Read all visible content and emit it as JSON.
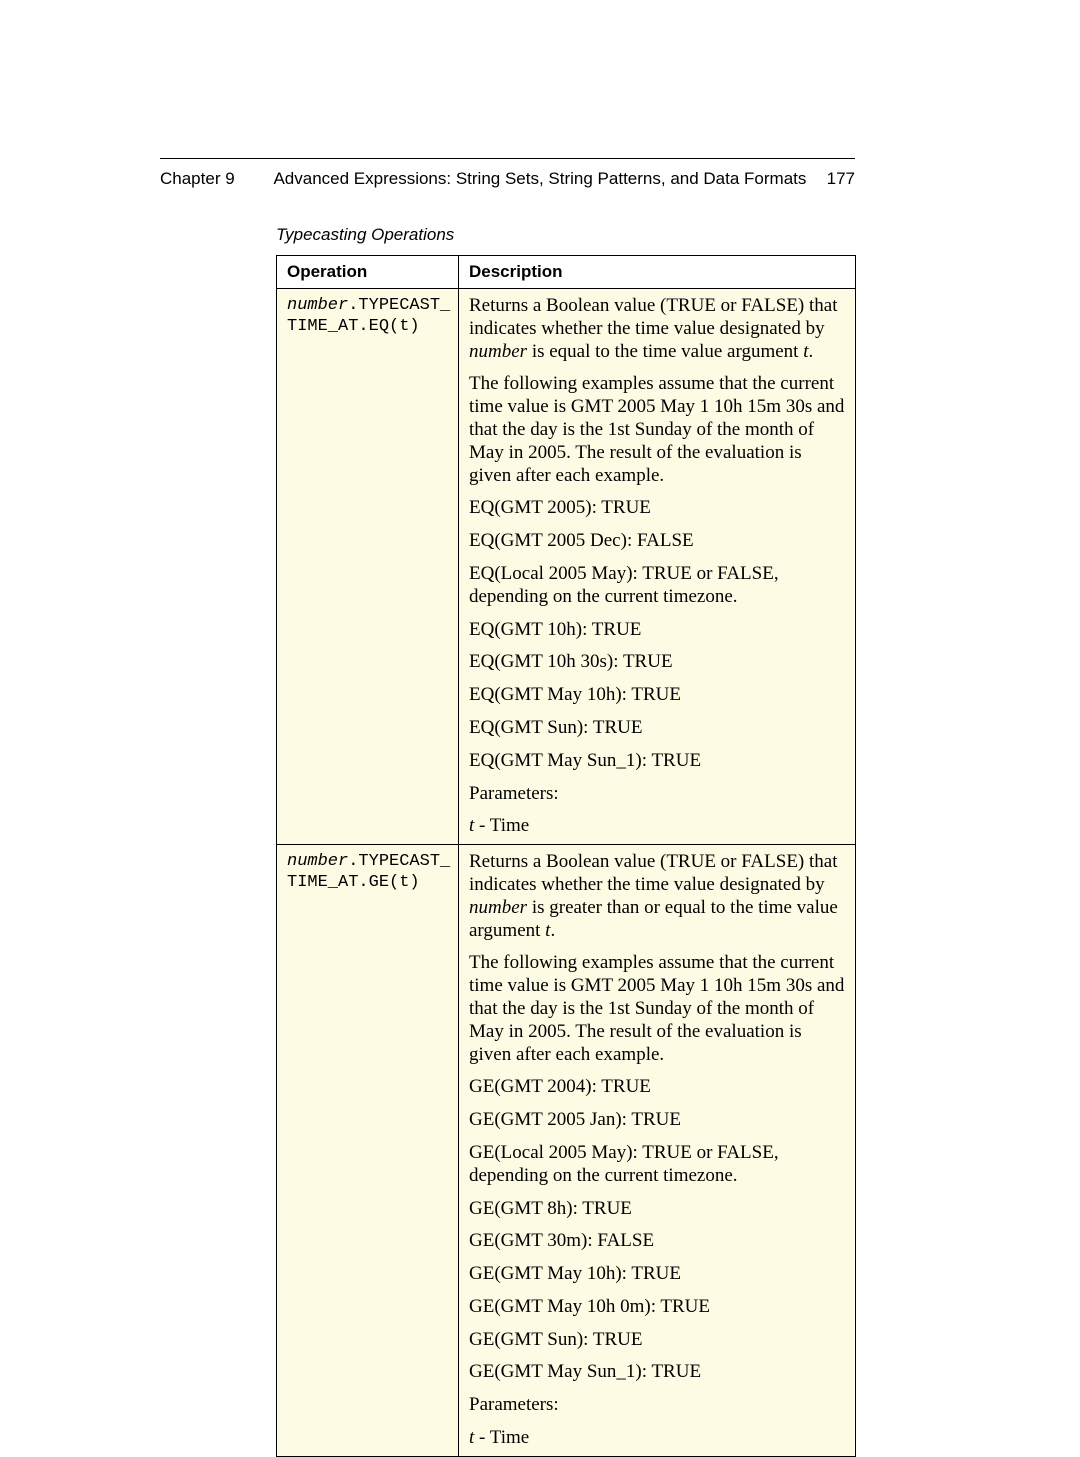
{
  "header": {
    "chapter": "Chapter 9",
    "title": "Advanced Expressions: String Sets, String Patterns, and Data Formats",
    "page": "177"
  },
  "caption": "Typecasting Operations",
  "columns": {
    "operation": "Operation",
    "description": "Description"
  },
  "rows": [
    {
      "op_prefix": "number",
      "op_code_line1": ".TYPECAST_",
      "op_code_line2": "TIME_AT.EQ(t)",
      "desc": {
        "intro_a": "Returns a Boolean value (TRUE or FALSE) that indicates whether the time value designated by ",
        "intro_num": "number",
        "intro_b": " is equal to the time value argument ",
        "intro_t": "t",
        "intro_c": ".",
        "assume": "The following examples assume that the current time value is GMT 2005 May 1 10h 15m 30s and that the day is the 1st Sunday of the month of May in 2005. The result of the evaluation is given after each example.",
        "ex1": "EQ(GMT 2005): TRUE",
        "ex2": "EQ(GMT 2005 Dec): FALSE",
        "ex3": "EQ(Local 2005 May): TRUE or FALSE, depending on the current timezone.",
        "ex4": "EQ(GMT 10h): TRUE",
        "ex5": "EQ(GMT 10h 30s): TRUE",
        "ex6": "EQ(GMT May 10h): TRUE",
        "ex7": "EQ(GMT Sun): TRUE",
        "ex8": "EQ(GMT May Sun_1): TRUE",
        "params_label": "Parameters:",
        "param_t_letter": "t",
        "param_t_rest": " - Time"
      }
    },
    {
      "op_prefix": "number",
      "op_code_line1": ".TYPECAST_",
      "op_code_line2": "TIME_AT.GE(t)",
      "desc": {
        "intro_a": "Returns a Boolean value (TRUE or FALSE) that indicates whether the time value designated by ",
        "intro_num": "number",
        "intro_b": " is greater than or equal to the time value argument ",
        "intro_t": "t",
        "intro_c": ".",
        "assume": "The following examples assume that the current time value is GMT 2005 May 1 10h 15m 30s and that the day is the 1st Sunday of the month of May in 2005. The result of the evaluation is given after each example.",
        "ex1": "GE(GMT 2004): TRUE",
        "ex2": "GE(GMT 2005 Jan): TRUE",
        "ex3": "GE(Local 2005 May): TRUE or FALSE, depending on the current timezone.",
        "ex4": "GE(GMT 8h): TRUE",
        "ex5": "GE(GMT 30m): FALSE",
        "ex6": "GE(GMT May 10h): TRUE",
        "ex7": "GE(GMT May 10h 0m): TRUE",
        "ex8": "GE(GMT Sun): TRUE",
        "ex9": "GE(GMT May Sun_1): TRUE",
        "params_label": "Parameters:",
        "param_t_letter": "t",
        "param_t_rest": " - Time"
      }
    }
  ]
}
